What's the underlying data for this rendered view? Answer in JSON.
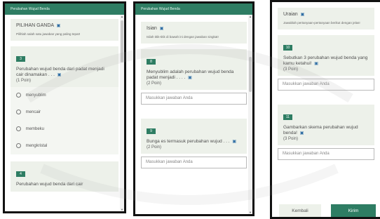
{
  "panel1": {
    "header": "Perubahan Wujud Benda",
    "section": {
      "title": "PILIHAN GANDA",
      "desc": "Pilihlah salah satu jawaban yang paling tepat!"
    },
    "q3": {
      "number": "3",
      "text": "Perubahan wujud benda dari padat menjadi cair dinamakan . . .",
      "points": "(1 Poin)",
      "options": [
        "menyublim",
        "mencair",
        "membeku",
        "mengkristal"
      ]
    },
    "q4": {
      "number": "4",
      "text": "Perubahan wujud benda dari cair"
    }
  },
  "panel2": {
    "header": "Perubahan Wujud Benda",
    "section": {
      "title": "Isian",
      "desc": "Isilah titik-titik di bawah ini dengan jawaban singkat!"
    },
    "q8": {
      "number": "8",
      "text": "Menyublim adalah perubahan wujud benda padat menjadi . . . .",
      "points": "(2 Poin)",
      "input_placeholder": "Masukkan jawaban Anda"
    },
    "q9": {
      "number": "9",
      "text": "Bunga es termasuk perubahan wujud . . .",
      "points": "(2 Poin)",
      "input_placeholder": "Masukkan jawaban Anda"
    }
  },
  "panel3": {
    "section": {
      "title": "Uraian",
      "desc": "Jawablah pertanyaan-pertanyaan berikut dengan jelas!"
    },
    "q10": {
      "number": "10",
      "text": "Sebutkan 3 perubahan wujud benda yang kamu ketahui!",
      "points": "(3 Poin)",
      "input_placeholder": "Masukkan jawaban Anda"
    },
    "q11": {
      "number": "11",
      "text": "Gambarkan skema perubahan wujud benda!",
      "points": "(3 Poin)",
      "input_placeholder": "Masukkan jawaban Anda"
    },
    "back_label": "Kembali",
    "submit_label": "Kirim"
  },
  "icons": {
    "info": "info-icon",
    "radio": "radio-button-icon"
  },
  "colors": {
    "header_green": "#2e7d63",
    "section_bg": "#edf1ea",
    "link_blue": "#2e6da4"
  }
}
